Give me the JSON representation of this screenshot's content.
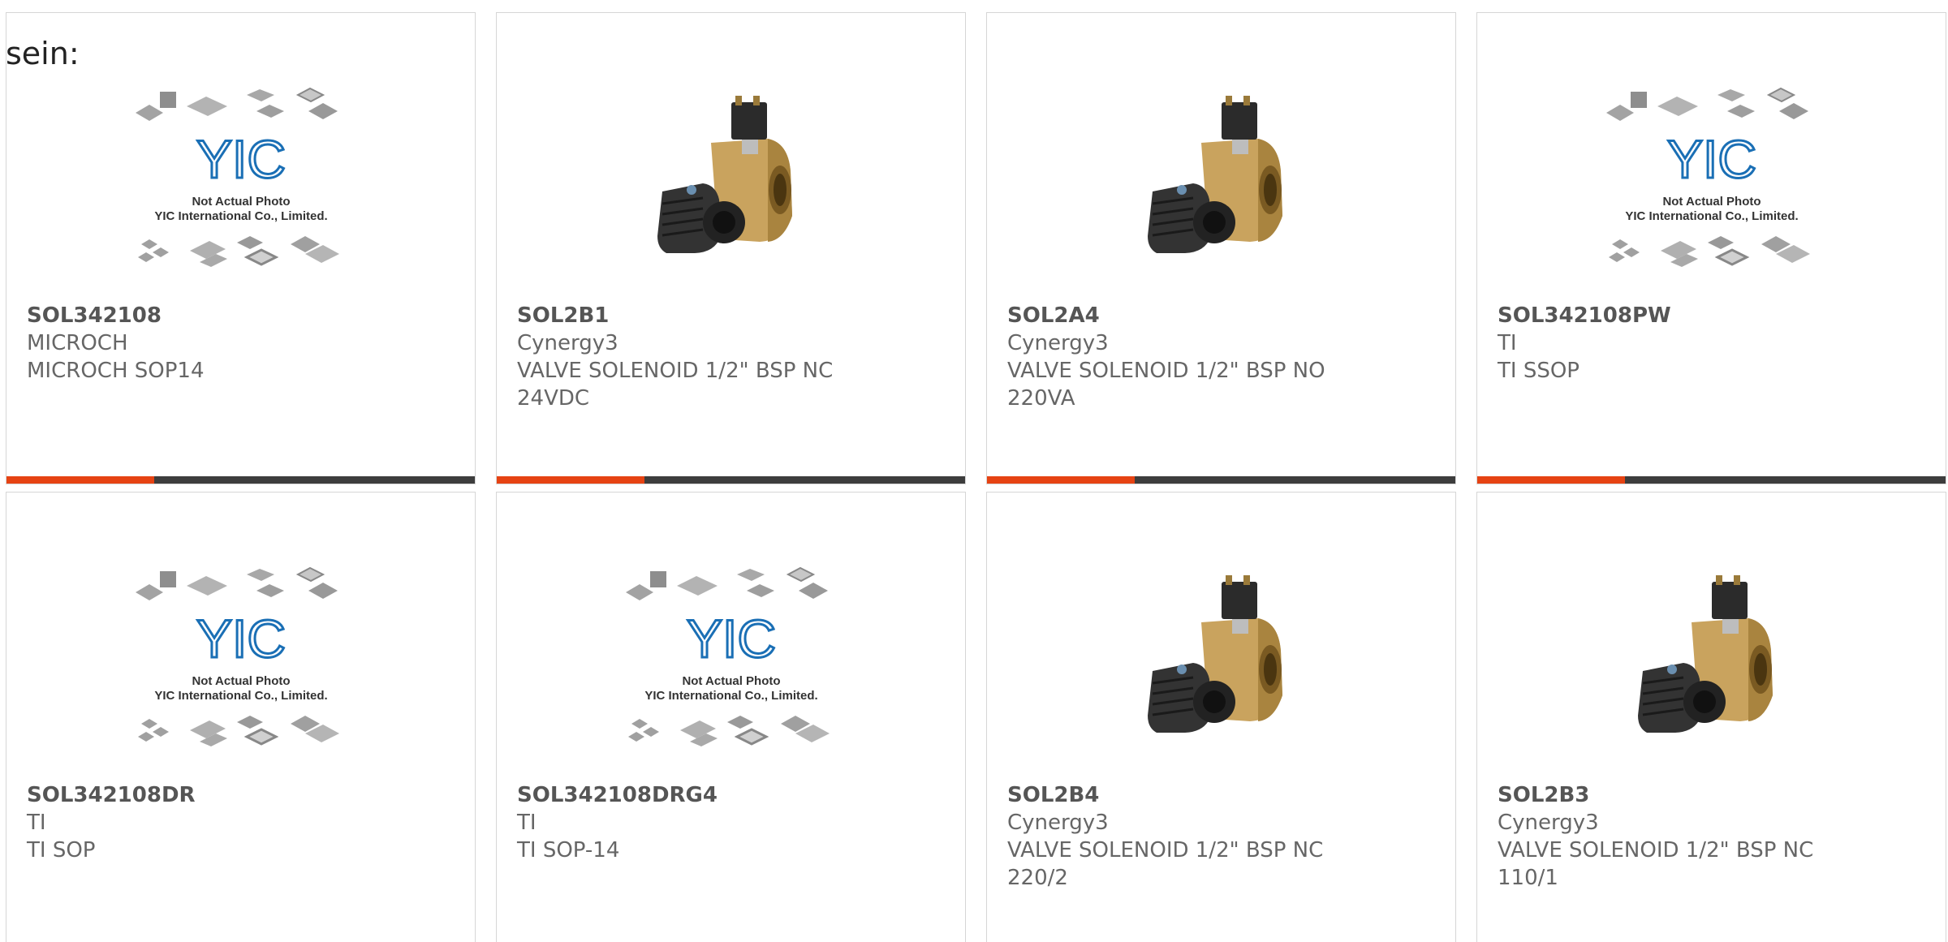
{
  "intro": {
    "text": "sein:"
  },
  "placeholder": {
    "logo_text": "YIC",
    "line1": "Not Actual Photo",
    "line2": "YIC International Co., Limited."
  },
  "colors": {
    "accent_bar": "#e64313",
    "dark_bar": "#3d3d3d",
    "logo_blue": "#1a6fb5",
    "text_gray": "#666666"
  },
  "products": [
    {
      "part_number": "SOL342108",
      "manufacturer": "MICROCH",
      "description": "MICROCH SOP14",
      "image": "yic-placeholder"
    },
    {
      "part_number": "SOL2B1",
      "manufacturer": "Cynergy3",
      "description": "VALVE SOLENOID 1/2\" BSP NC 24VDC",
      "image": "solenoid-valve"
    },
    {
      "part_number": "SOL2A4",
      "manufacturer": "Cynergy3",
      "description": "VALVE SOLENOID 1/2\" BSP NO 220VA",
      "image": "solenoid-valve"
    },
    {
      "part_number": "SOL342108PW",
      "manufacturer": "TI",
      "description": "TI SSOP",
      "image": "yic-placeholder"
    },
    {
      "part_number": "SOL342108DR",
      "manufacturer": "TI",
      "description": "TI SOP",
      "image": "yic-placeholder"
    },
    {
      "part_number": "SOL342108DRG4",
      "manufacturer": "TI",
      "description": "TI SOP-14",
      "image": "yic-placeholder"
    },
    {
      "part_number": "SOL2B4",
      "manufacturer": "Cynergy3",
      "description": "VALVE SOLENOID 1/2\" BSP NC 220/2",
      "image": "solenoid-valve"
    },
    {
      "part_number": "SOL2B3",
      "manufacturer": "Cynergy3",
      "description": "VALVE SOLENOID 1/2\" BSP NC 110/1",
      "image": "solenoid-valve"
    }
  ]
}
